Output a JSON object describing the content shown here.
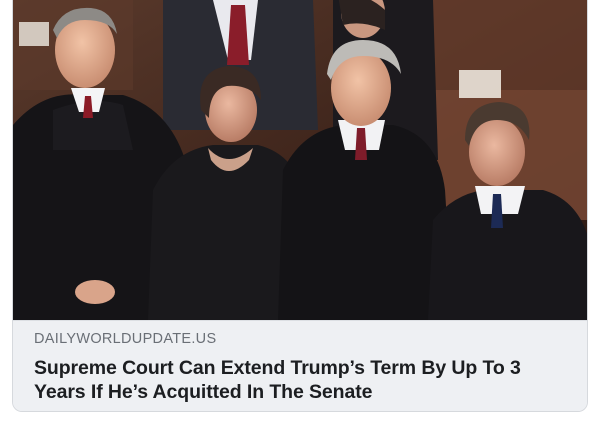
{
  "link_preview": {
    "domain": "DAILYWORLDUPDATE.US",
    "headline": "Supreme Court Can Extend Trump’s Term By Up To 3 Years If He’s Acquitted In The Senate"
  },
  "colors": {
    "card_background": "#eef0f3",
    "domain_text": "#6a6f76",
    "headline_text": "#1c1e21",
    "card_border": "#d6d9dd"
  }
}
